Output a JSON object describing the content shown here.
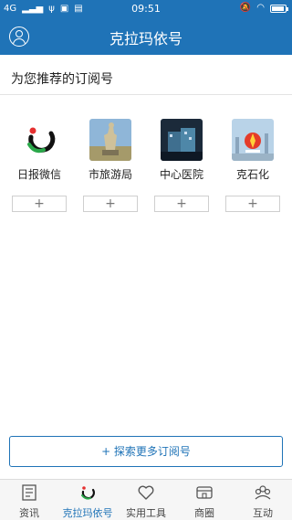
{
  "status_bar": {
    "network": "4G",
    "time": "09:51"
  },
  "header": {
    "title": "克拉玛依号"
  },
  "recommend": {
    "title": "为您推荐的订阅号",
    "items": [
      {
        "name": "日报微信",
        "add_label": "+"
      },
      {
        "name": "市旅游局",
        "add_label": "+"
      },
      {
        "name": "中心医院",
        "add_label": "+"
      },
      {
        "name": "克石化",
        "add_label": "+"
      }
    ]
  },
  "explore_button": {
    "label": "+ 探索更多订阅号"
  },
  "tabs": [
    {
      "label": "资讯",
      "icon": "news-icon",
      "active": false
    },
    {
      "label": "克拉玛依号",
      "icon": "karamay-logo-icon",
      "active": true
    },
    {
      "label": "实用工具",
      "icon": "heart-icon",
      "active": false
    },
    {
      "label": "商圈",
      "icon": "shop-icon",
      "active": false
    },
    {
      "label": "互动",
      "icon": "community-icon",
      "active": false
    }
  ],
  "colors": {
    "primary": "#1f73b7",
    "tab_active": "#1f73b7"
  }
}
